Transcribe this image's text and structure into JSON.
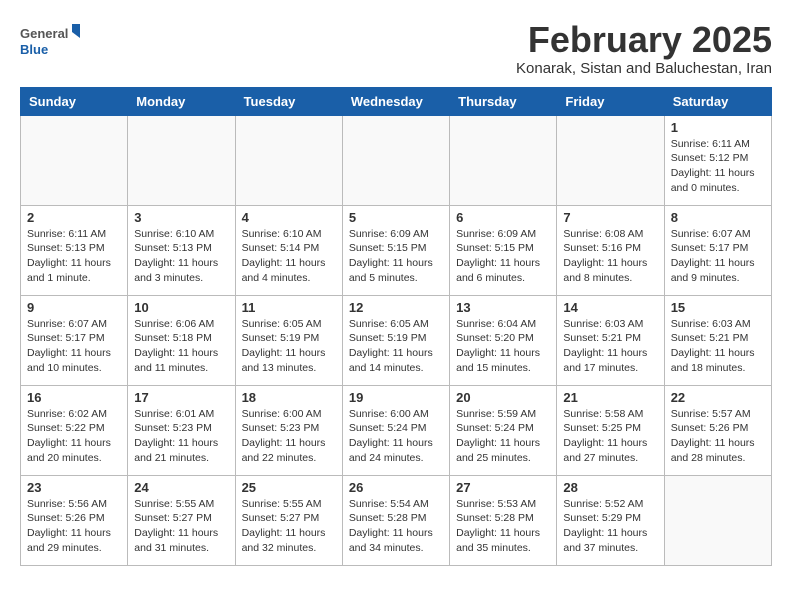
{
  "header": {
    "logo_general": "General",
    "logo_blue": "Blue",
    "month_title": "February 2025",
    "subtitle": "Konarak, Sistan and Baluchestan, Iran"
  },
  "days_of_week": [
    "Sunday",
    "Monday",
    "Tuesday",
    "Wednesday",
    "Thursday",
    "Friday",
    "Saturday"
  ],
  "weeks": [
    [
      {
        "day": "",
        "info": ""
      },
      {
        "day": "",
        "info": ""
      },
      {
        "day": "",
        "info": ""
      },
      {
        "day": "",
        "info": ""
      },
      {
        "day": "",
        "info": ""
      },
      {
        "day": "",
        "info": ""
      },
      {
        "day": "1",
        "info": "Sunrise: 6:11 AM\nSunset: 5:12 PM\nDaylight: 11 hours\nand 0 minutes."
      }
    ],
    [
      {
        "day": "2",
        "info": "Sunrise: 6:11 AM\nSunset: 5:13 PM\nDaylight: 11 hours\nand 1 minute."
      },
      {
        "day": "3",
        "info": "Sunrise: 6:10 AM\nSunset: 5:13 PM\nDaylight: 11 hours\nand 3 minutes."
      },
      {
        "day": "4",
        "info": "Sunrise: 6:10 AM\nSunset: 5:14 PM\nDaylight: 11 hours\nand 4 minutes."
      },
      {
        "day": "5",
        "info": "Sunrise: 6:09 AM\nSunset: 5:15 PM\nDaylight: 11 hours\nand 5 minutes."
      },
      {
        "day": "6",
        "info": "Sunrise: 6:09 AM\nSunset: 5:15 PM\nDaylight: 11 hours\nand 6 minutes."
      },
      {
        "day": "7",
        "info": "Sunrise: 6:08 AM\nSunset: 5:16 PM\nDaylight: 11 hours\nand 8 minutes."
      },
      {
        "day": "8",
        "info": "Sunrise: 6:07 AM\nSunset: 5:17 PM\nDaylight: 11 hours\nand 9 minutes."
      }
    ],
    [
      {
        "day": "9",
        "info": "Sunrise: 6:07 AM\nSunset: 5:17 PM\nDaylight: 11 hours\nand 10 minutes."
      },
      {
        "day": "10",
        "info": "Sunrise: 6:06 AM\nSunset: 5:18 PM\nDaylight: 11 hours\nand 11 minutes."
      },
      {
        "day": "11",
        "info": "Sunrise: 6:05 AM\nSunset: 5:19 PM\nDaylight: 11 hours\nand 13 minutes."
      },
      {
        "day": "12",
        "info": "Sunrise: 6:05 AM\nSunset: 5:19 PM\nDaylight: 11 hours\nand 14 minutes."
      },
      {
        "day": "13",
        "info": "Sunrise: 6:04 AM\nSunset: 5:20 PM\nDaylight: 11 hours\nand 15 minutes."
      },
      {
        "day": "14",
        "info": "Sunrise: 6:03 AM\nSunset: 5:21 PM\nDaylight: 11 hours\nand 17 minutes."
      },
      {
        "day": "15",
        "info": "Sunrise: 6:03 AM\nSunset: 5:21 PM\nDaylight: 11 hours\nand 18 minutes."
      }
    ],
    [
      {
        "day": "16",
        "info": "Sunrise: 6:02 AM\nSunset: 5:22 PM\nDaylight: 11 hours\nand 20 minutes."
      },
      {
        "day": "17",
        "info": "Sunrise: 6:01 AM\nSunset: 5:23 PM\nDaylight: 11 hours\nand 21 minutes."
      },
      {
        "day": "18",
        "info": "Sunrise: 6:00 AM\nSunset: 5:23 PM\nDaylight: 11 hours\nand 22 minutes."
      },
      {
        "day": "19",
        "info": "Sunrise: 6:00 AM\nSunset: 5:24 PM\nDaylight: 11 hours\nand 24 minutes."
      },
      {
        "day": "20",
        "info": "Sunrise: 5:59 AM\nSunset: 5:24 PM\nDaylight: 11 hours\nand 25 minutes."
      },
      {
        "day": "21",
        "info": "Sunrise: 5:58 AM\nSunset: 5:25 PM\nDaylight: 11 hours\nand 27 minutes."
      },
      {
        "day": "22",
        "info": "Sunrise: 5:57 AM\nSunset: 5:26 PM\nDaylight: 11 hours\nand 28 minutes."
      }
    ],
    [
      {
        "day": "23",
        "info": "Sunrise: 5:56 AM\nSunset: 5:26 PM\nDaylight: 11 hours\nand 29 minutes."
      },
      {
        "day": "24",
        "info": "Sunrise: 5:55 AM\nSunset: 5:27 PM\nDaylight: 11 hours\nand 31 minutes."
      },
      {
        "day": "25",
        "info": "Sunrise: 5:55 AM\nSunset: 5:27 PM\nDaylight: 11 hours\nand 32 minutes."
      },
      {
        "day": "26",
        "info": "Sunrise: 5:54 AM\nSunset: 5:28 PM\nDaylight: 11 hours\nand 34 minutes."
      },
      {
        "day": "27",
        "info": "Sunrise: 5:53 AM\nSunset: 5:28 PM\nDaylight: 11 hours\nand 35 minutes."
      },
      {
        "day": "28",
        "info": "Sunrise: 5:52 AM\nSunset: 5:29 PM\nDaylight: 11 hours\nand 37 minutes."
      },
      {
        "day": "",
        "info": ""
      }
    ]
  ]
}
